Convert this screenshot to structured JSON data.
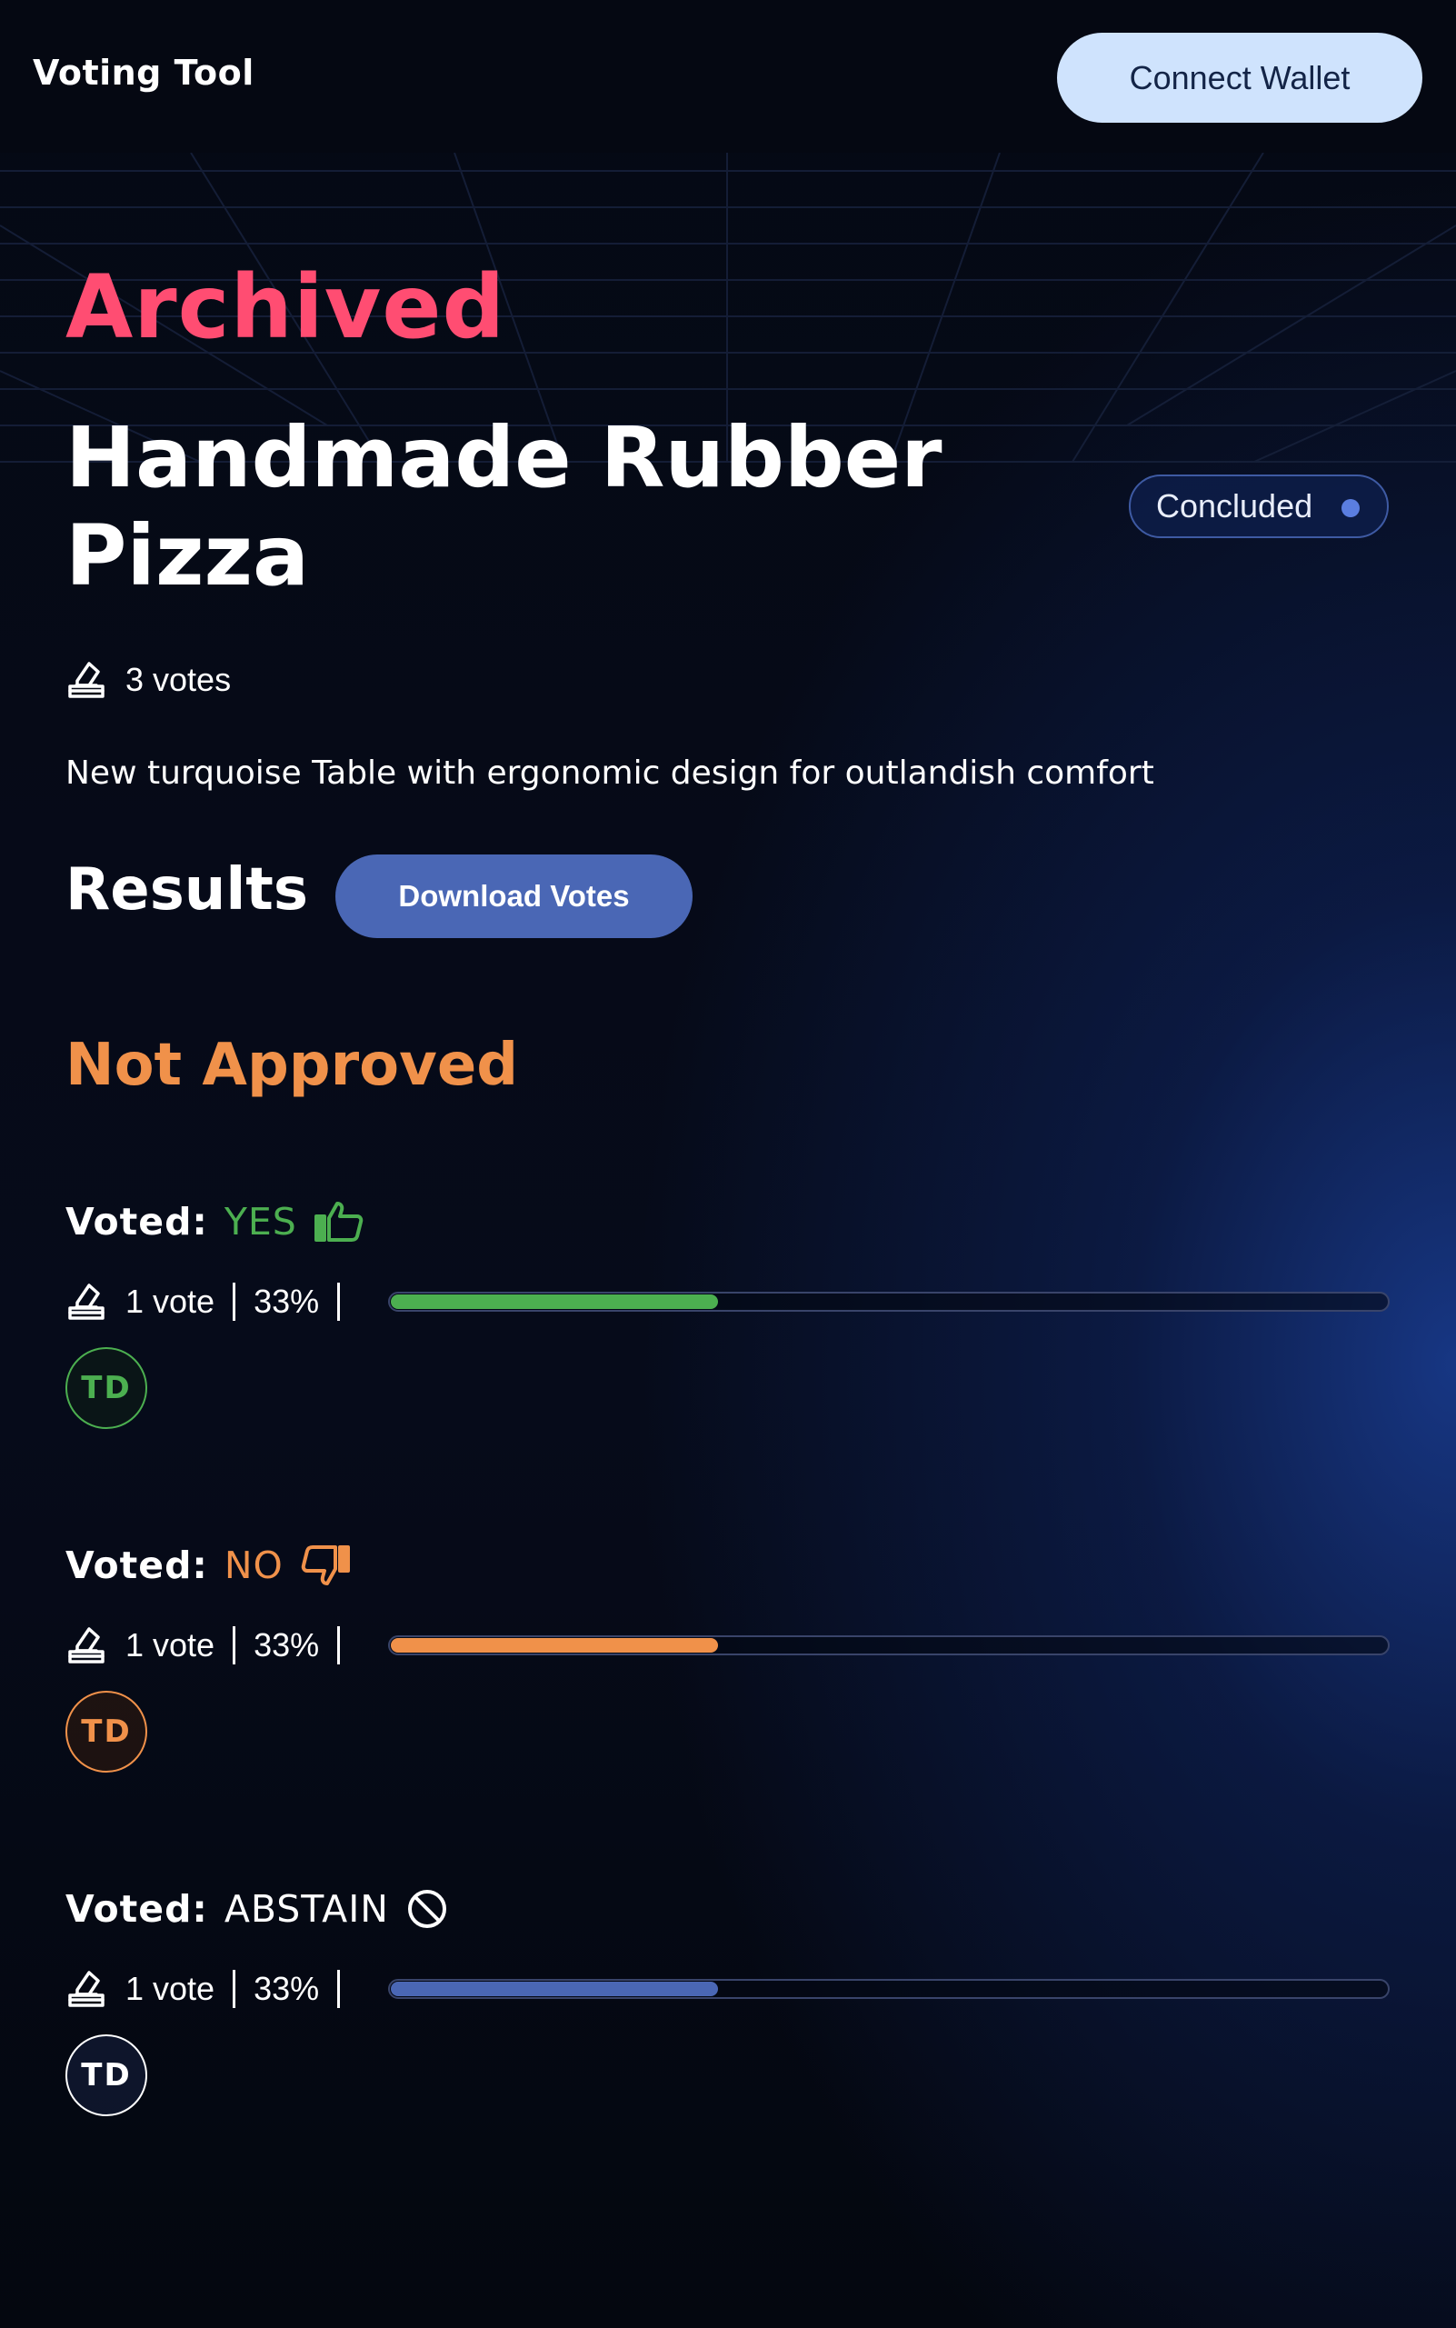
{
  "header": {
    "app_title": "Voting Tool",
    "connect_button": "Connect Wallet"
  },
  "proposal": {
    "state_label": "Archived",
    "title": "Handmade Rubber Pizza",
    "status_badge": "Concluded",
    "votes_total": "3 votes",
    "description": "New turquoise Table with ergonomic design for outlandish comfort"
  },
  "results": {
    "title": "Results",
    "download_button": "Download Votes",
    "outcome": "Not Approved",
    "voted_prefix": "Voted:",
    "options": [
      {
        "choice": "YES",
        "votes": "1 vote",
        "percent": "33%",
        "share": 0.33,
        "voter_initials": "TD",
        "icon": "thumbs-up-icon",
        "color": "#4caf50"
      },
      {
        "choice": "NO",
        "votes": "1 vote",
        "percent": "33%",
        "share": 0.33,
        "voter_initials": "TD",
        "icon": "thumbs-down-icon",
        "color": "#f0914a"
      },
      {
        "choice": "ABSTAIN",
        "votes": "1 vote",
        "percent": "33%",
        "share": 0.33,
        "voter_initials": "TD",
        "icon": "abstain-icon",
        "color": "#4a67b5"
      }
    ]
  },
  "colors": {
    "archived": "#ff4d72",
    "outcome": "#f0914a",
    "connect_button_bg": "#cfe3fd",
    "download_button_bg": "#4a67b5"
  }
}
